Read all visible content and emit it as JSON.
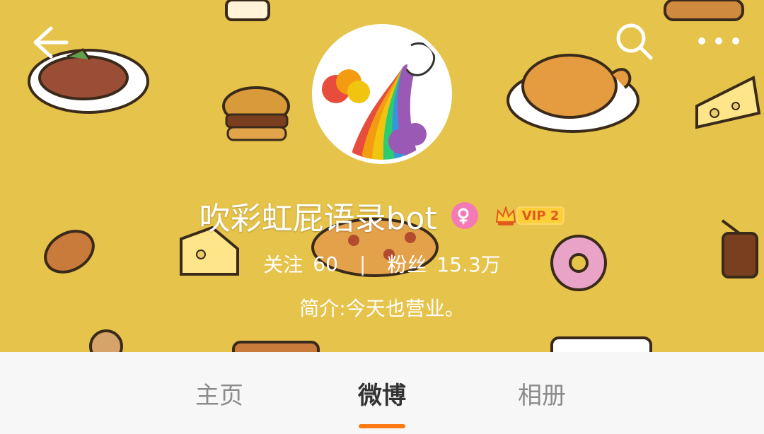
{
  "profile": {
    "name": "吹彩虹屁语录bot",
    "vip_label": "VIP 2",
    "stats": {
      "following_label": "关注",
      "following_count": "60",
      "separator": "|",
      "followers_label": "粉丝",
      "followers_count": "15.3万"
    },
    "bio": "简介:今天也营业。"
  },
  "tabs": [
    {
      "label": "主页"
    },
    {
      "label": "微博"
    },
    {
      "label": "相册"
    }
  ],
  "colors": {
    "header_bg": "#e6c34a",
    "tab_active_underline": "#ff7a14",
    "gender_badge": "#f47ab7"
  }
}
